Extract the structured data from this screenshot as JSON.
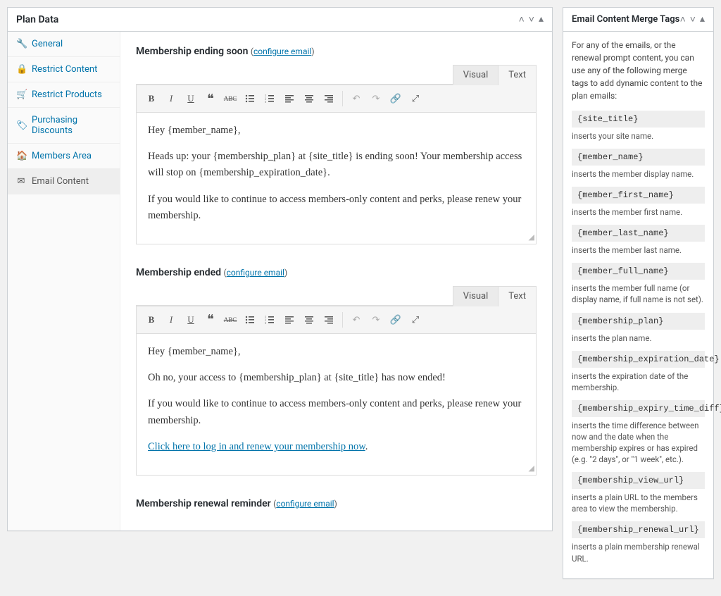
{
  "plan_data": {
    "title": "Plan Data",
    "tabs": [
      {
        "icon": "🔧",
        "label": "General"
      },
      {
        "icon": "🔒",
        "label": "Restrict Content"
      },
      {
        "icon": "🛒",
        "label": "Restrict Products"
      },
      {
        "icon": "🏷",
        "label": "Purchasing Discounts"
      },
      {
        "icon": "🏠",
        "label": "Members Area"
      },
      {
        "icon": "✉",
        "label": "Email Content"
      }
    ]
  },
  "editor": {
    "visual_tab": "Visual",
    "text_tab": "Text",
    "configure_link": "configure email"
  },
  "sections": [
    {
      "title": "Membership ending soon",
      "body": [
        "Hey {member_name},",
        "Heads up: your {membership_plan} at {site_title} is ending soon! Your membership access will stop on {membership_expiration_date}.",
        "If you would like to continue to access members-only content and perks, please renew your membership."
      ]
    },
    {
      "title": "Membership ended",
      "body": [
        "Hey {member_name},",
        "Oh no, your access to {membership_plan} at {site_title} has now ended!",
        "If you would like to continue to access members-only content and perks, please renew your membership."
      ],
      "link_text": "Click here to log in and renew your membership now"
    },
    {
      "title": "Membership renewal reminder"
    }
  ],
  "merge_panel": {
    "title": "Email Content Merge Tags",
    "intro": "For any of the emails, or the renewal prompt content, you can use any of the following merge tags to add dynamic content to the plan emails:",
    "tags": [
      {
        "code": "{site_title}",
        "desc": "inserts your site name."
      },
      {
        "code": "{member_name}",
        "desc": "inserts the member display name."
      },
      {
        "code": "{member_first_name}",
        "desc": "inserts the member first name."
      },
      {
        "code": "{member_last_name}",
        "desc": "inserts the member last name."
      },
      {
        "code": "{member_full_name}",
        "desc": "inserts the member full name (or display name, if full name is not set)."
      },
      {
        "code": "{membership_plan}",
        "desc": "inserts the plan name."
      },
      {
        "code": "{membership_expiration_date}",
        "desc": "inserts the expiration date of the membership."
      },
      {
        "code": "{membership_expiry_time_diff}",
        "desc": "inserts the time difference between now and the date when the membership expires or has expired (e.g. \"2 days\", or \"1 week\", etc.)."
      },
      {
        "code": "{membership_view_url}",
        "desc": "inserts a plain URL to the members area to view the membership."
      },
      {
        "code": "{membership_renewal_url}",
        "desc": "inserts a plain membership renewal URL."
      }
    ]
  }
}
